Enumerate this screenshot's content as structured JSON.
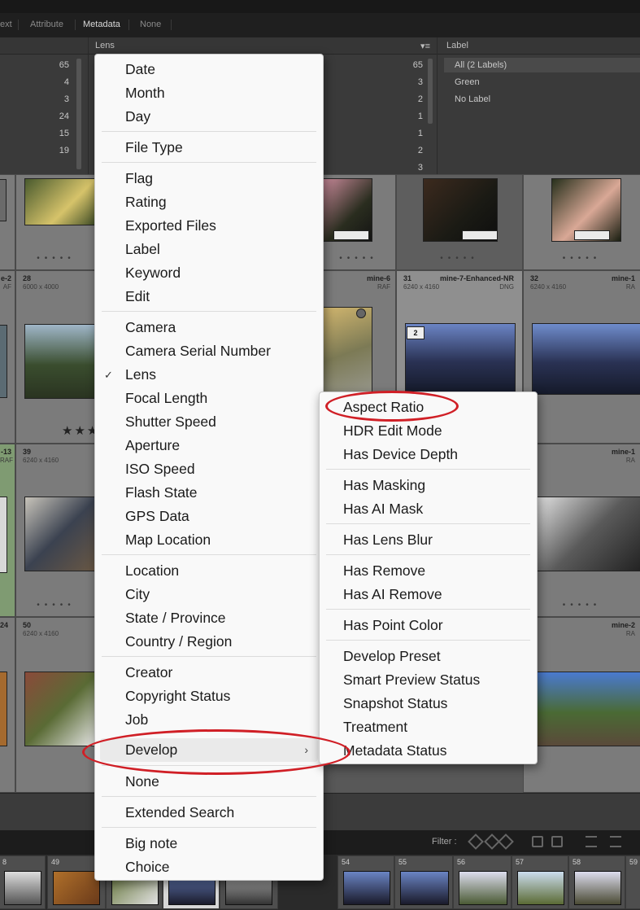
{
  "filter_bar": {
    "tabs": [
      "ext",
      "Attribute",
      "Metadata",
      "None"
    ],
    "active_tab": "Metadata"
  },
  "metadata_browser": {
    "left_counts": [
      "65",
      "4",
      "3",
      "24",
      "15",
      "19"
    ],
    "lens_header": "Lens",
    "lens_counts": [
      "65",
      "3",
      "2",
      "1",
      "1",
      "2",
      "3"
    ],
    "label_header": "Label",
    "label_items": [
      "All (2 Labels)",
      "Green",
      "No Label"
    ]
  },
  "grid": {
    "row2": [
      {
        "num": "28",
        "name": "",
        "dims": "6000 x 4000",
        "ext": ""
      },
      {
        "num": "",
        "name": "mine-6",
        "dims": "",
        "ext": "RAF"
      },
      {
        "num": "31",
        "name": "mine-7-Enhanced-NR",
        "dims": "6240 x 4160",
        "ext": "DNG"
      },
      {
        "num": "32",
        "name": "mine-1",
        "dims": "6240 x 4160",
        "ext": "RA"
      }
    ],
    "row2_left_name": "e-2",
    "row2_left_ext": "AF",
    "row3": [
      {
        "num": "39",
        "dims": "6240 x 4160"
      },
      {
        "num": "",
        "name": "mine-1",
        "ext": "RA"
      }
    ],
    "row3_left_name": "-13",
    "row3_left_ext": "RAF",
    "row4": [
      {
        "num": "50",
        "dims": "6240 x 4160"
      },
      {
        "num": "",
        "name": "mine-2",
        "ext": "RA"
      }
    ],
    "row4_left_num": "24",
    "stack_badge": "2",
    "stars": "★★★"
  },
  "bottom": {
    "filter_label": "Filter :",
    "filmstrip_numbers": [
      "8",
      "49",
      "",
      "",
      "54",
      "55",
      "56",
      "57",
      "58",
      "59"
    ],
    "filmstrip_badge": "2"
  },
  "main_menu": {
    "groups": [
      [
        "Date",
        "Month",
        "Day"
      ],
      [
        "File Type"
      ],
      [
        "Flag",
        "Rating",
        "Exported Files",
        "Label",
        "Keyword",
        "Edit"
      ],
      [
        "Camera",
        "Camera Serial Number",
        "Lens",
        "Focal Length",
        "Shutter Speed",
        "Aperture",
        "ISO Speed",
        "Flash State",
        "GPS Data",
        "Map Location"
      ],
      [
        "Location",
        "City",
        "State / Province",
        "Country / Region"
      ],
      [
        "Creator",
        "Copyright Status",
        "Job",
        "Develop"
      ],
      [
        "None"
      ],
      [
        "Extended Search"
      ],
      [
        "Big note",
        "Choice"
      ]
    ],
    "checked_item": "Lens",
    "check_glyph": "✓",
    "highlighted_item": "Develop",
    "submenu_chevron": "›"
  },
  "develop_submenu": {
    "groups": [
      [
        "Aspect Ratio",
        "HDR Edit Mode",
        "Has Device Depth"
      ],
      [
        "Has Masking",
        "Has AI Mask"
      ],
      [
        "Has Lens Blur"
      ],
      [
        "Has Remove",
        "Has AI Remove"
      ],
      [
        "Has Point Color"
      ],
      [
        "Develop Preset",
        "Smart Preview Status",
        "Snapshot Status",
        "Treatment",
        "Metadata Status"
      ]
    ]
  },
  "annotations": {
    "highlight_color": "#d01f26"
  }
}
